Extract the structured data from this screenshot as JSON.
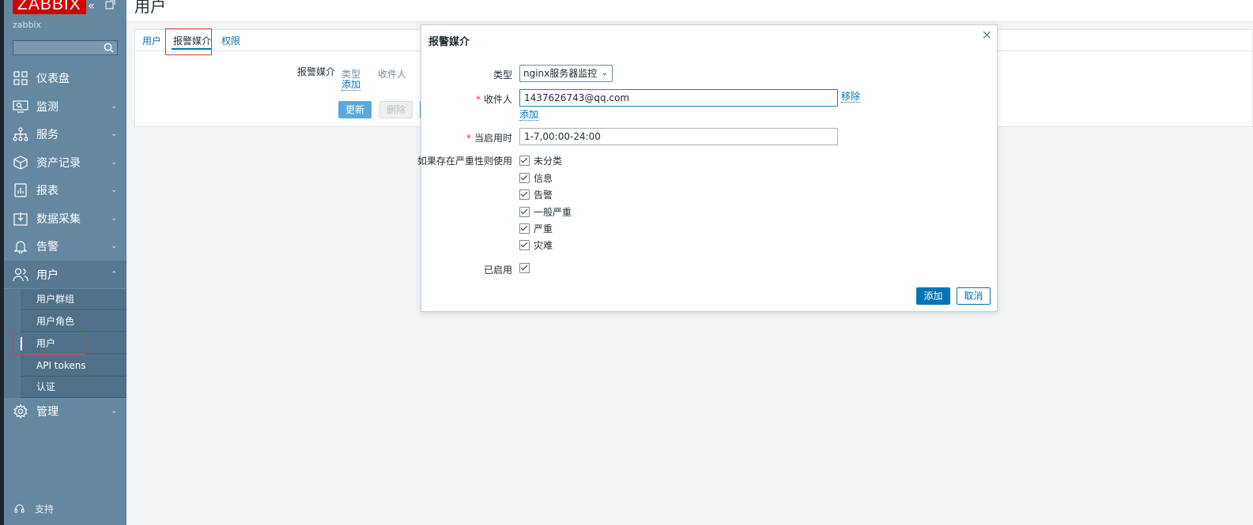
{
  "sidebar": {
    "logo": "ZABBIX",
    "server_name": "zabbix",
    "search_placeholder": "",
    "items": [
      {
        "label": "仪表盘",
        "icon": "dashboard-icon"
      },
      {
        "label": "监测",
        "icon": "monitoring-icon"
      },
      {
        "label": "服务",
        "icon": "services-icon"
      },
      {
        "label": "资产记录",
        "icon": "inventory-icon"
      },
      {
        "label": "报表",
        "icon": "reports-icon"
      },
      {
        "label": "数据采集",
        "icon": "data-collection-icon"
      },
      {
        "label": "告警",
        "icon": "alerts-icon"
      },
      {
        "label": "用户",
        "icon": "users-icon"
      },
      {
        "label": "管理",
        "icon": "administration-icon"
      }
    ],
    "user_submenu": [
      "用户群组",
      "用户角色",
      "用户",
      "API tokens",
      "认证"
    ],
    "support": "支持"
  },
  "page": {
    "title": "用户",
    "tabs": [
      "用户",
      "报警媒介",
      "权限"
    ],
    "media_label": "报警媒介",
    "media_headers": [
      "类型",
      "收件人"
    ],
    "media_add": "添加",
    "update": "更新",
    "delete": "删除"
  },
  "modal": {
    "title": "报警媒介",
    "type_label": "类型",
    "type_value": "nginx服务器监控",
    "recipient_label": "收件人",
    "recipient_value": "1437626743@qq.com",
    "remove": "移除",
    "add_recipient": "添加",
    "active_label": "当启用时",
    "active_value": "1-7,00:00-24:00",
    "severity_label": "如果存在严重性则使用",
    "severities": [
      "未分类",
      "信息",
      "告警",
      "一般严重",
      "严重",
      "灾难"
    ],
    "enabled_label": "已启用",
    "add_button": "添加",
    "cancel_button": "取消"
  },
  "colors": {
    "sidebar": "#6488a0",
    "accent": "#0275b8",
    "logo": "#d40000",
    "highlight": "#e53935"
  }
}
